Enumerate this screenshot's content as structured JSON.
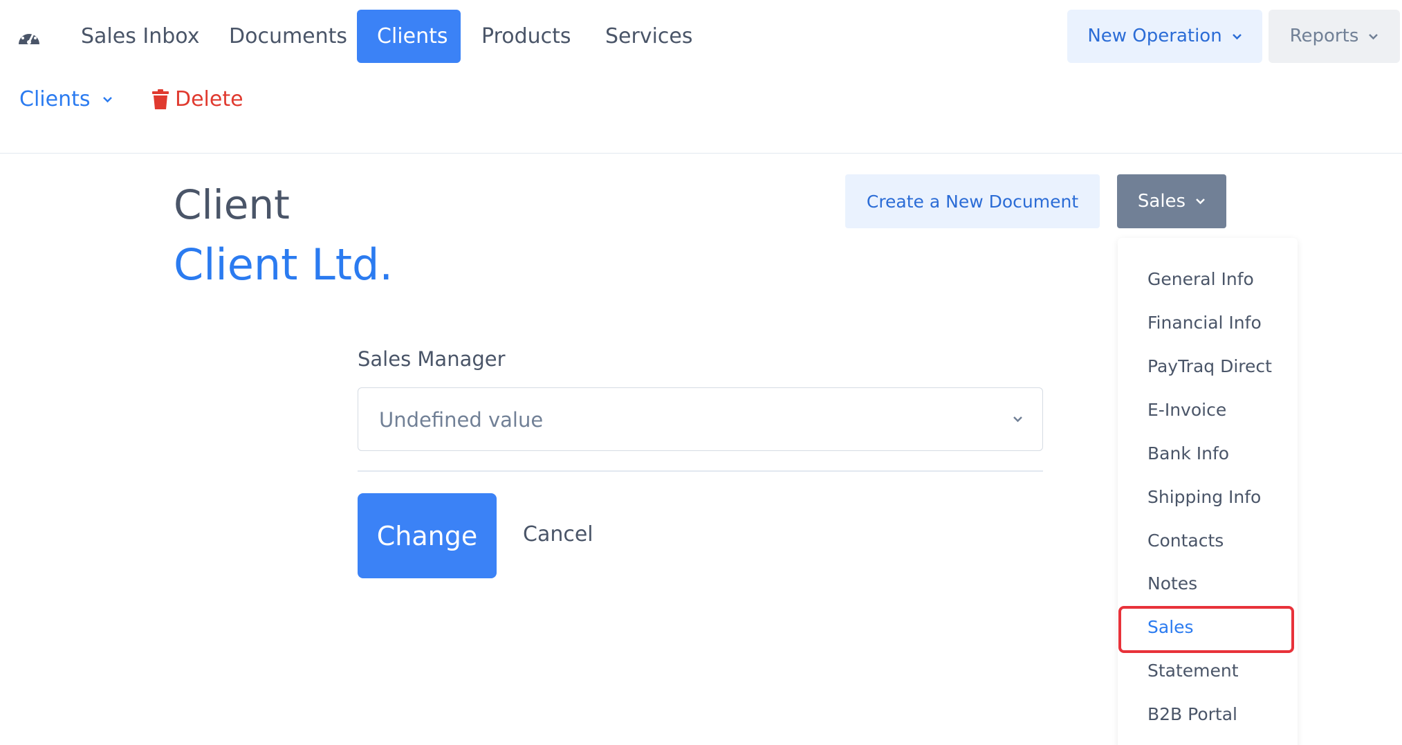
{
  "nav": {
    "items": [
      {
        "label": "Sales Inbox"
      },
      {
        "label": "Documents"
      },
      {
        "label": "Clients"
      },
      {
        "label": "Products"
      },
      {
        "label": "Services"
      }
    ],
    "active": "Clients",
    "new_operation_label": "New Operation",
    "reports_label": "Reports"
  },
  "subbar": {
    "clients_label": "Clients",
    "delete_label": "Delete"
  },
  "header": {
    "title": "Client",
    "client_name": "Client Ltd.",
    "create_document_label": "Create a New Document",
    "sales_menu_label": "Sales"
  },
  "menu": {
    "items": [
      {
        "label": "General Info"
      },
      {
        "label": "Financial Info"
      },
      {
        "label": "PayTraq Direct"
      },
      {
        "label": "E-Invoice"
      },
      {
        "label": "Bank Info"
      },
      {
        "label": "Shipping Info"
      },
      {
        "label": "Contacts"
      },
      {
        "label": "Notes"
      },
      {
        "label": "Sales"
      },
      {
        "label": "Statement"
      },
      {
        "label": "B2B Portal"
      }
    ],
    "selected": "Sales"
  },
  "form": {
    "field_label": "Sales Manager",
    "select_value": "Undefined value",
    "change_label": "Change",
    "cancel_label": "Cancel"
  },
  "colors": {
    "accent": "#3b82f6",
    "link": "#2b7bf0",
    "danger": "#e03a2f",
    "highlight": "#e8323a",
    "muted": "#718096"
  }
}
